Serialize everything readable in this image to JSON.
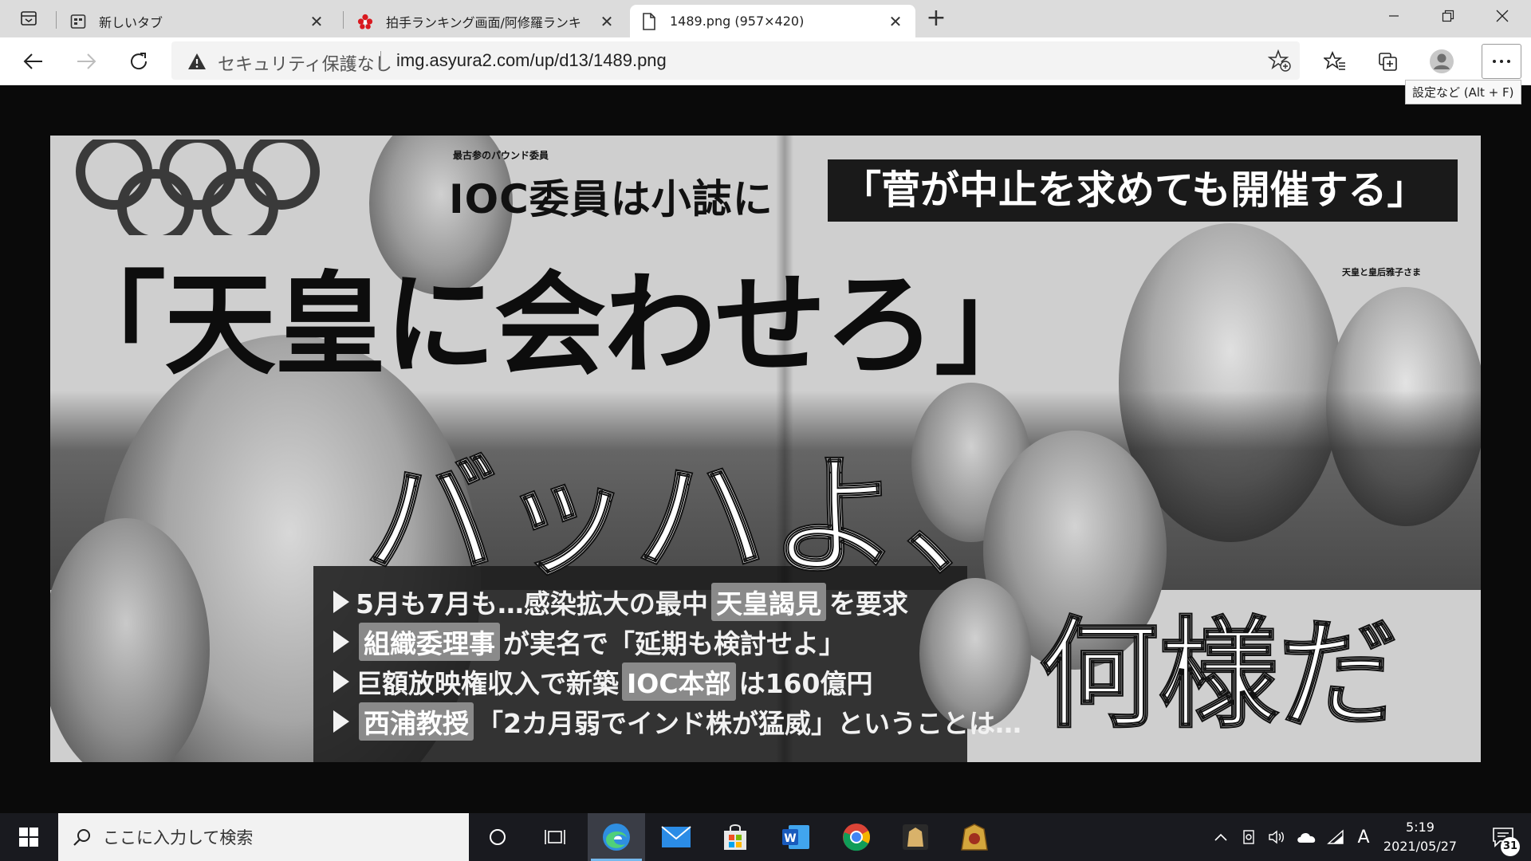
{
  "browser": {
    "tabs": [
      {
        "title": "新しいタブ",
        "active": false
      },
      {
        "title": "拍手ランキング画面/阿修羅ランキ",
        "active": false
      },
      {
        "title": "1489.png (957×420)",
        "active": true
      }
    ],
    "address": {
      "security_label": "セキュリティ保護なし",
      "url": "img.asyura2.com/up/d13/1489.png"
    },
    "tooltip": "設定など (Alt + F)"
  },
  "content": {
    "small_caption_pound": "最古参のパウンド委員",
    "headline_ioc": "IOC委員は小誌に",
    "headline_suga_quote": "「菅が中止を求めても開催する」",
    "headline_main": "「天皇に会わせろ」",
    "headline_bach": "バッハよ、",
    "headline_nanisama": "何様だ",
    "caption_emperor": "天皇と皇后雅子さま",
    "bullets": [
      {
        "pre": "5月も7月も…感染拡大の最中",
        "box": "天皇謁見",
        "post": "を要求"
      },
      {
        "pre": "",
        "box": "組織委理事",
        "post": "が実名で「延期も検討せよ」"
      },
      {
        "pre": "巨額放映権収入で新築",
        "box": "IOC本部",
        "post": "は160億円"
      },
      {
        "pre": "",
        "box": "西浦教授",
        "post": "「2カ月弱でインド株が猛威」ということは…"
      }
    ]
  },
  "taskbar": {
    "search_placeholder": "ここに入力して検索",
    "time": "5:19",
    "date": "2021/05/27",
    "ime": "A",
    "notification_count": "31"
  },
  "colors": {
    "edge_blue": "#2f8ee0",
    "taskbar": "#191a1f",
    "tab_strip": "#dcdcdc"
  }
}
